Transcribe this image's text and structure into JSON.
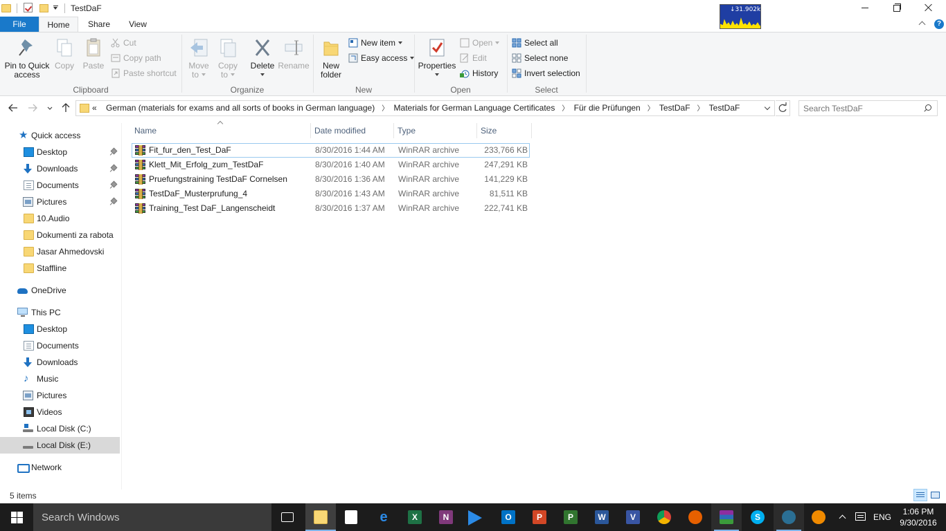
{
  "window": {
    "title": "TestDaF",
    "net_monitor": "↓31.902kB"
  },
  "ribbon_tabs": {
    "file": "File",
    "home": "Home",
    "share": "Share",
    "view": "View"
  },
  "ribbon": {
    "clipboard": {
      "label": "Clipboard",
      "pin": [
        "Pin to Quick",
        "access"
      ],
      "copy": "Copy",
      "paste": "Paste",
      "cut": "Cut",
      "copy_path": "Copy path",
      "paste_shortcut": "Paste shortcut"
    },
    "organize": {
      "label": "Organize",
      "move_to": [
        "Move",
        "to"
      ],
      "copy_to": [
        "Copy",
        "to"
      ],
      "delete": "Delete",
      "rename": "Rename"
    },
    "new": {
      "label": "New",
      "new_folder": [
        "New",
        "folder"
      ],
      "new_item": "New item",
      "easy_access": "Easy access"
    },
    "open": {
      "label": "Open",
      "properties": "Properties",
      "open": "Open",
      "edit": "Edit",
      "history": "History"
    },
    "select": {
      "label": "Select",
      "select_all": "Select all",
      "select_none": "Select none",
      "invert_selection": "Invert selection"
    }
  },
  "address": {
    "overflow": "«",
    "crumbs": [
      "German (materials for exams and all sorts of books in German language)",
      "Materials for German Language Certificates",
      "Für die Prüfungen",
      "TestDaF",
      "TestDaF"
    ],
    "search_placeholder": "Search TestDaF"
  },
  "nav": {
    "quick_access": "Quick access",
    "quick_items": [
      "Desktop",
      "Downloads",
      "Documents",
      "Pictures",
      "10.Audio",
      "Dokumenti za rabota",
      "Jasar Ahmedovski",
      "Staffline"
    ],
    "onedrive": "OneDrive",
    "this_pc": "This PC",
    "pc_items": [
      "Desktop",
      "Documents",
      "Downloads",
      "Music",
      "Pictures",
      "Videos",
      "Local Disk (C:)",
      "Local Disk (E:)"
    ],
    "network": "Network"
  },
  "columns": {
    "name": "Name",
    "date": "Date modified",
    "type": "Type",
    "size": "Size"
  },
  "files": [
    {
      "name": "Fit_fur_den_Test_DaF",
      "date": "8/30/2016 1:44 AM",
      "type": "WinRAR archive",
      "size": "233,766 KB"
    },
    {
      "name": "Klett_Mit_Erfolg_zum_TestDaF",
      "date": "8/30/2016 1:40 AM",
      "type": "WinRAR archive",
      "size": "247,291 KB"
    },
    {
      "name": "Pruefungstraining TestDaF Cornelsen",
      "date": "8/30/2016 1:36 AM",
      "type": "WinRAR archive",
      "size": "141,229 KB"
    },
    {
      "name": "TestDaF_Musterprufung_4",
      "date": "8/30/2016 1:43 AM",
      "type": "WinRAR archive",
      "size": "81,511 KB"
    },
    {
      "name": "Training_Test DaF_Langenscheidt",
      "date": "8/30/2016 1:37 AM",
      "type": "WinRAR archive",
      "size": "222,741 KB"
    }
  ],
  "status": {
    "count": "5 items"
  },
  "taskbar": {
    "search": "Search Windows",
    "lang": "ENG",
    "time": "1:06 PM",
    "date": "9/30/2016",
    "icons": [
      "task-view-icon",
      "file-explorer-icon",
      "store-icon",
      "edge-icon",
      "excel-icon",
      "onenote-icon",
      "media-player-icon",
      "outlook-icon",
      "powerpoint-icon",
      "project-icon",
      "word-icon",
      "visio-icon",
      "chrome-icon",
      "firefox-icon",
      "winrar-icon",
      "skype-icon",
      "network-meter-icon",
      "vlc-icon"
    ]
  }
}
